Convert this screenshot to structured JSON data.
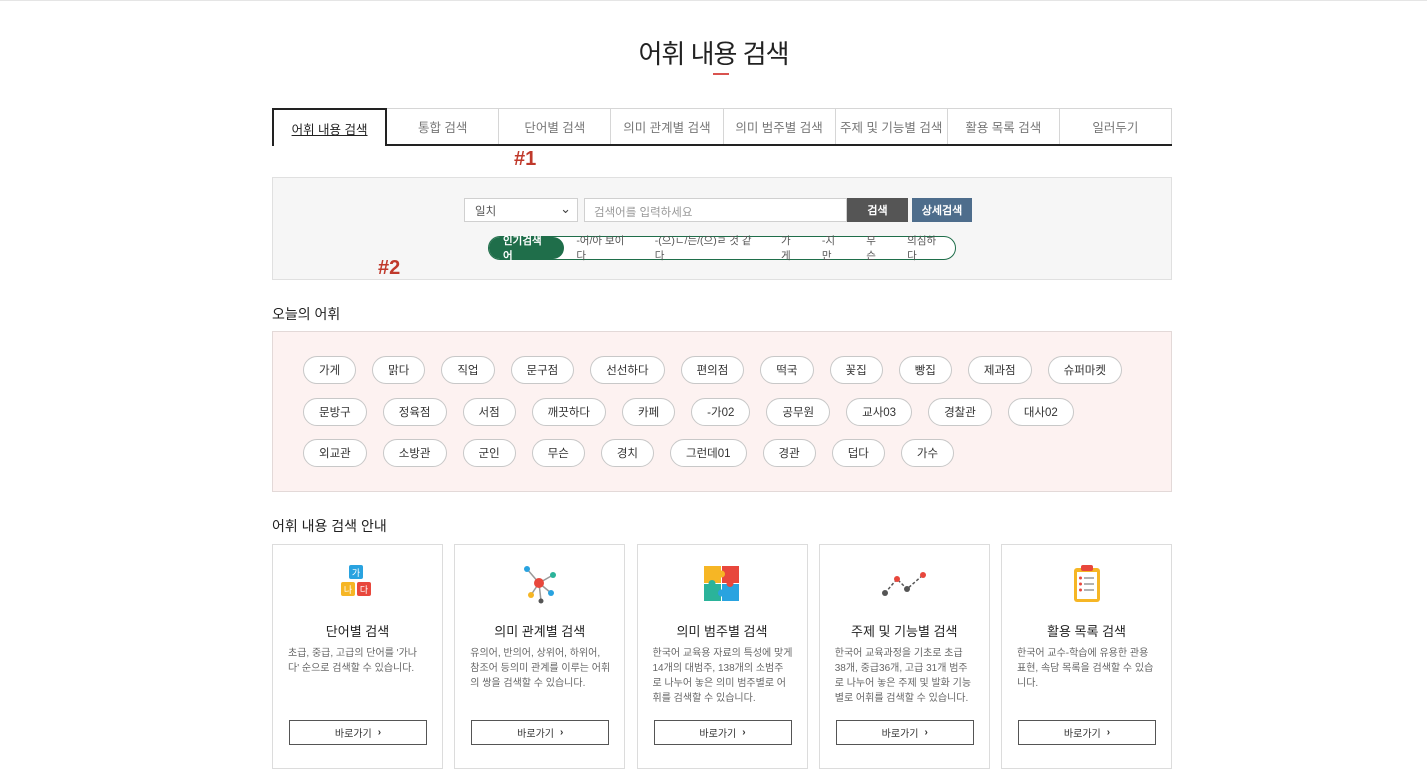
{
  "page": {
    "title": "어휘 내용 검색"
  },
  "tabs": [
    {
      "label": "어휘 내용 검색",
      "active": true
    },
    {
      "label": "통합 검색"
    },
    {
      "label": "단어별 검색"
    },
    {
      "label": "의미 관계별 검색"
    },
    {
      "label": "의미 범주별 검색"
    },
    {
      "label": "주제 및 기능별 검색"
    },
    {
      "label": "활용 목록 검색"
    },
    {
      "label": "일러두기"
    }
  ],
  "markers": {
    "m1": "#1",
    "m2": "#2"
  },
  "search": {
    "select_value": "일치",
    "placeholder": "검색어를 입력하세요",
    "search_button": "검색",
    "detail_button": "상세검색",
    "popular_label": "인기검색어",
    "popular": [
      "-어/아 보이다",
      "-(으)ㄴ/는/(으)ㄹ 것 같다",
      "가게",
      "-지만",
      "무슨",
      "의심하다"
    ]
  },
  "today": {
    "title": "오늘의 어휘",
    "rows": [
      [
        "가게",
        "맑다",
        "직업",
        "문구점",
        "선선하다",
        "편의점",
        "떡국",
        "꽃집",
        "빵집",
        "제과점",
        "슈퍼마켓"
      ],
      [
        "문방구",
        "정육점",
        "서점",
        "깨끗하다",
        "카페",
        "-가02",
        "공무원",
        "교사03",
        "경찰관",
        "대사02"
      ],
      [
        "외교관",
        "소방관",
        "군인",
        "무슨",
        "경치",
        "그런데01",
        "경관",
        "덥다",
        "가수"
      ]
    ]
  },
  "guide": {
    "title": "어휘 내용 검색 안내",
    "button_label": "바로가기",
    "cards": [
      {
        "icon": "ganada-blocks-icon",
        "title": "단어별 검색",
        "desc": "초급, 중급, 고급의 단어를 '가나다' 순으로 검색할 수 있습니다."
      },
      {
        "icon": "network-nodes-icon",
        "title": "의미 관계별 검색",
        "desc": "유의어, 반의어, 상위어, 하위어, 참조어 등의미 관계를 이루는 어휘의 쌍을 검색할 수 있습니다."
      },
      {
        "icon": "puzzle-icon",
        "title": "의미 범주별 검색",
        "desc": "한국어 교육용 자료의 특성에 맞게 14개의 대범주, 138개의 소범주로 나누어 놓은 의미 범주별로 어휘를 검색할 수 있습니다."
      },
      {
        "icon": "trend-line-icon",
        "title": "주제 및 기능별 검색",
        "desc": "한국어 교육과정을 기초로 초급 38개, 중급36개, 고급 31개 범주로 나누어 놓은 주제 및 발화 기능별로 어휘를 검색할 수 있습니다."
      },
      {
        "icon": "clipboard-icon",
        "title": "활용 목록 검색",
        "desc": "한국어 교수-학습에 유용한 관용 표현, 속담 목록을 검색할 수 있습니다."
      }
    ]
  }
}
